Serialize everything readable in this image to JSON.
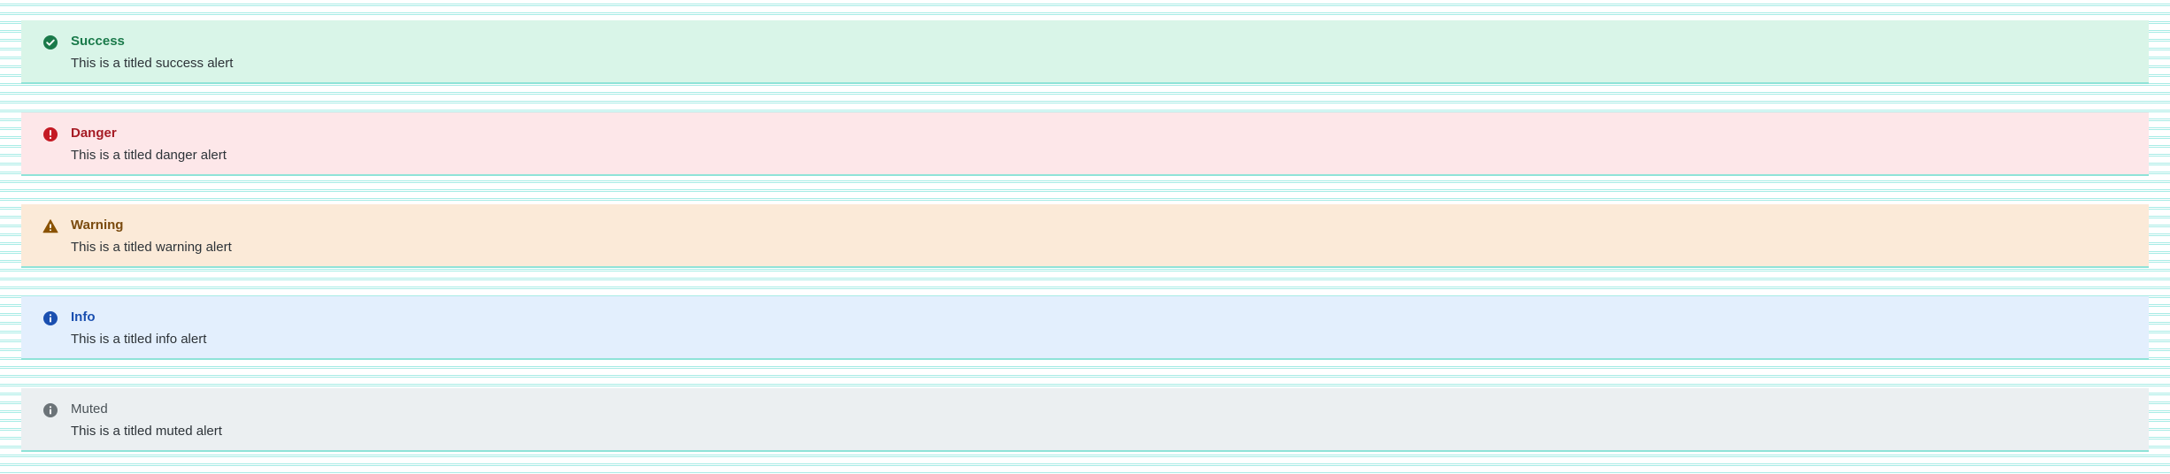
{
  "alerts": [
    {
      "variant": "success",
      "icon": "check-circle-icon",
      "color": "#1a7a4a",
      "background": "#d9f5e8",
      "title": "Success",
      "message": "This is a titled success alert"
    },
    {
      "variant": "danger",
      "icon": "exclamation-circle-icon",
      "color": "#a61b24",
      "background": "#fde7e9",
      "title": "Danger",
      "message": "This is a titled danger alert"
    },
    {
      "variant": "warning",
      "icon": "warning-triangle-icon",
      "color": "#8a5200",
      "background": "#fbead8",
      "title": "Warning",
      "message": "This is a titled warning alert"
    },
    {
      "variant": "info",
      "icon": "info-circle-icon",
      "color": "#1a4fb0",
      "background": "#e3effd",
      "title": "Info",
      "message": "This is a titled info alert"
    },
    {
      "variant": "muted",
      "icon": "info-circle-icon",
      "color": "#6b7378",
      "background": "#ebeff1",
      "title": "Muted",
      "message": "This is a titled muted alert"
    }
  ]
}
